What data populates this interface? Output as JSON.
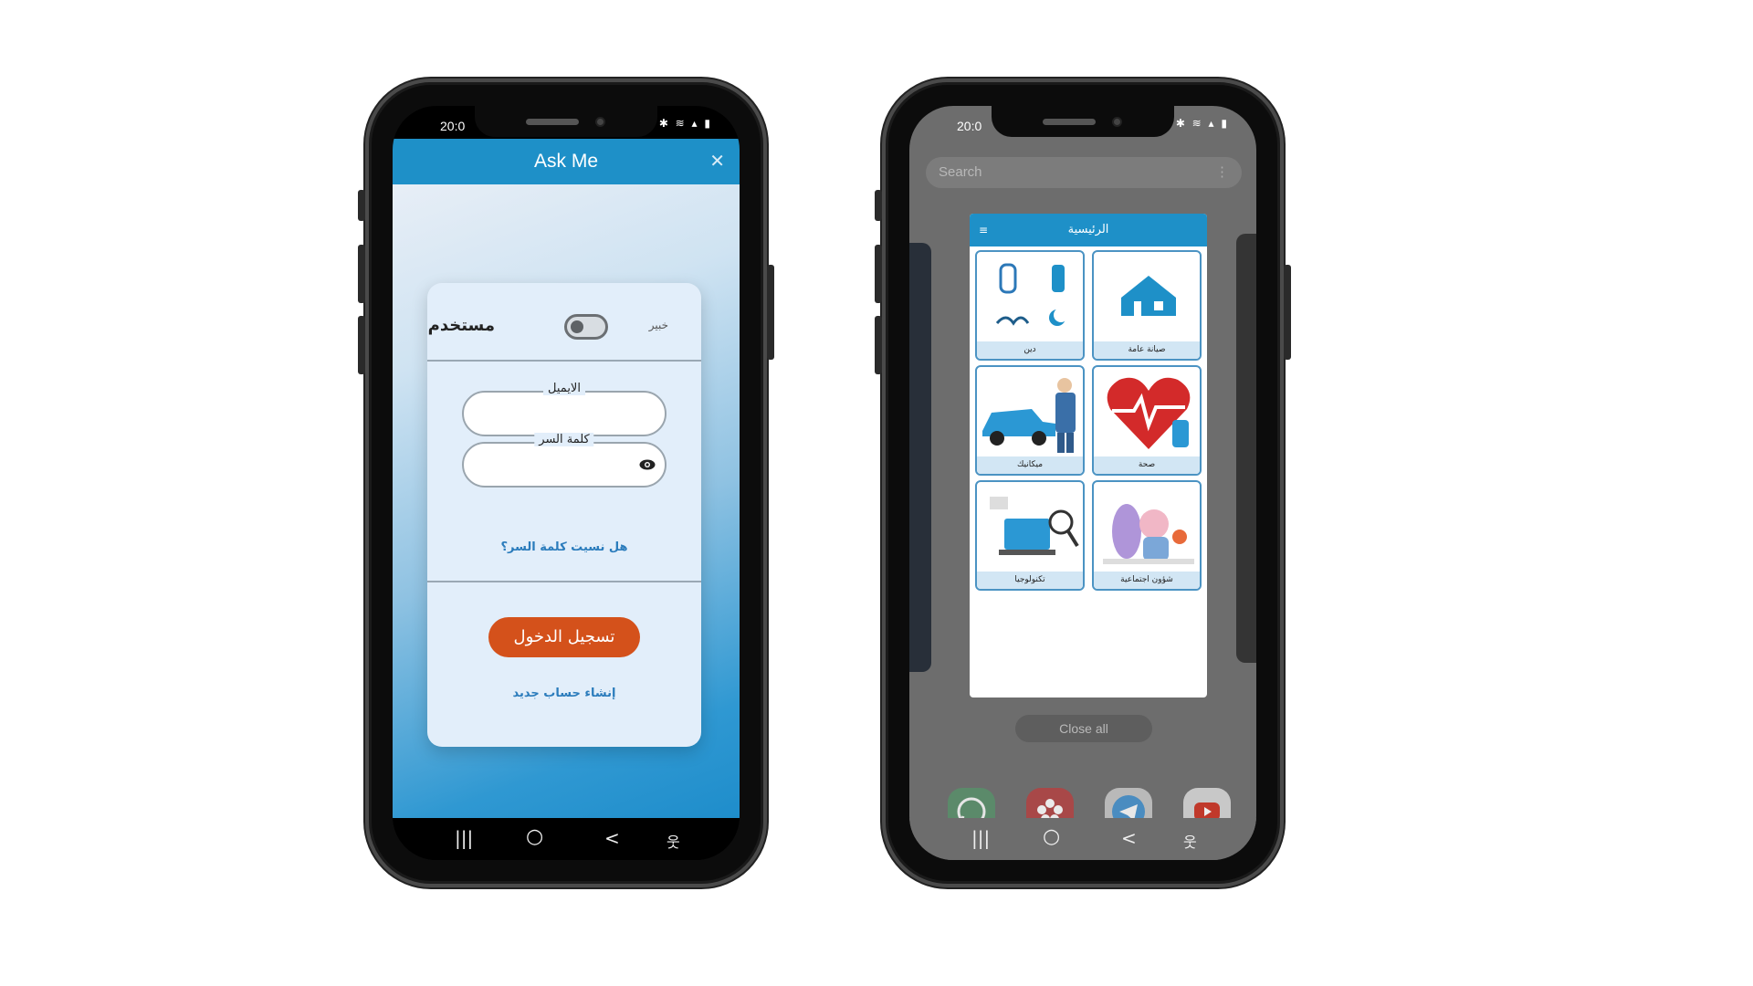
{
  "left_phone": {
    "status": {
      "time": "20:0",
      "icons": "✱ ≋ ▴ ▮"
    },
    "app": {
      "title": "Ask Me",
      "close_symbol": "✕",
      "header_color": "#1e90c8",
      "user_label": "مستخدم",
      "expert_label": "خبير",
      "toggle_state": "off",
      "email_label": "الايميل",
      "email_value": "",
      "password_label": "كلمة السر",
      "password_value": "",
      "eye_icon": "eye-icon",
      "forgot_password": "هل نسيت كلمة السر؟",
      "login_button": "تسجيل الدخول",
      "login_color": "#d4511b",
      "create_account": "إنشاء حساب جديد"
    },
    "navbar": {
      "recents": "|||",
      "home": "○",
      "back": "<",
      "accessibility": "웃"
    }
  },
  "right_phone": {
    "status": {
      "time": "20:0",
      "icons": "✱ ≋ ▴ ▮"
    },
    "search": {
      "placeholder": "Search",
      "more": "⋮"
    },
    "preview": {
      "title": "الرئيسية",
      "menu_icon": "≡",
      "tiles": [
        {
          "label": "دين",
          "icon": "religion-icon"
        },
        {
          "label": "صيانة عامة",
          "icon": "maintenance-icon"
        },
        {
          "label": "ميكانيك",
          "icon": "car-mechanic-icon"
        },
        {
          "label": "صحة",
          "icon": "health-heart-icon"
        },
        {
          "label": "تكنولوجيا",
          "icon": "technology-icon"
        },
        {
          "label": "شؤون اجتماعية",
          "icon": "social-affairs-icon"
        }
      ]
    },
    "close_all": "Close all",
    "dock": [
      "whatsapp-icon",
      "flower-gallery-icon",
      "telegram-icon",
      "youtube-icon"
    ],
    "navbar": {
      "recents": "|||",
      "home": "○",
      "back": "<",
      "accessibility": "웃"
    }
  }
}
